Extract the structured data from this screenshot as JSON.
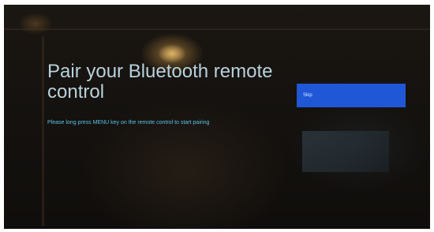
{
  "screen": {
    "title": "Pair your Bluetooth remote control",
    "instruction": "Please long press MENU key on the remote control to start pairing"
  },
  "actions": {
    "skip_label": "Skip"
  },
  "colors": {
    "accent": "#1f57d6",
    "title_text": "#b9d2dc",
    "instruction_text": "#5bc3e8"
  }
}
